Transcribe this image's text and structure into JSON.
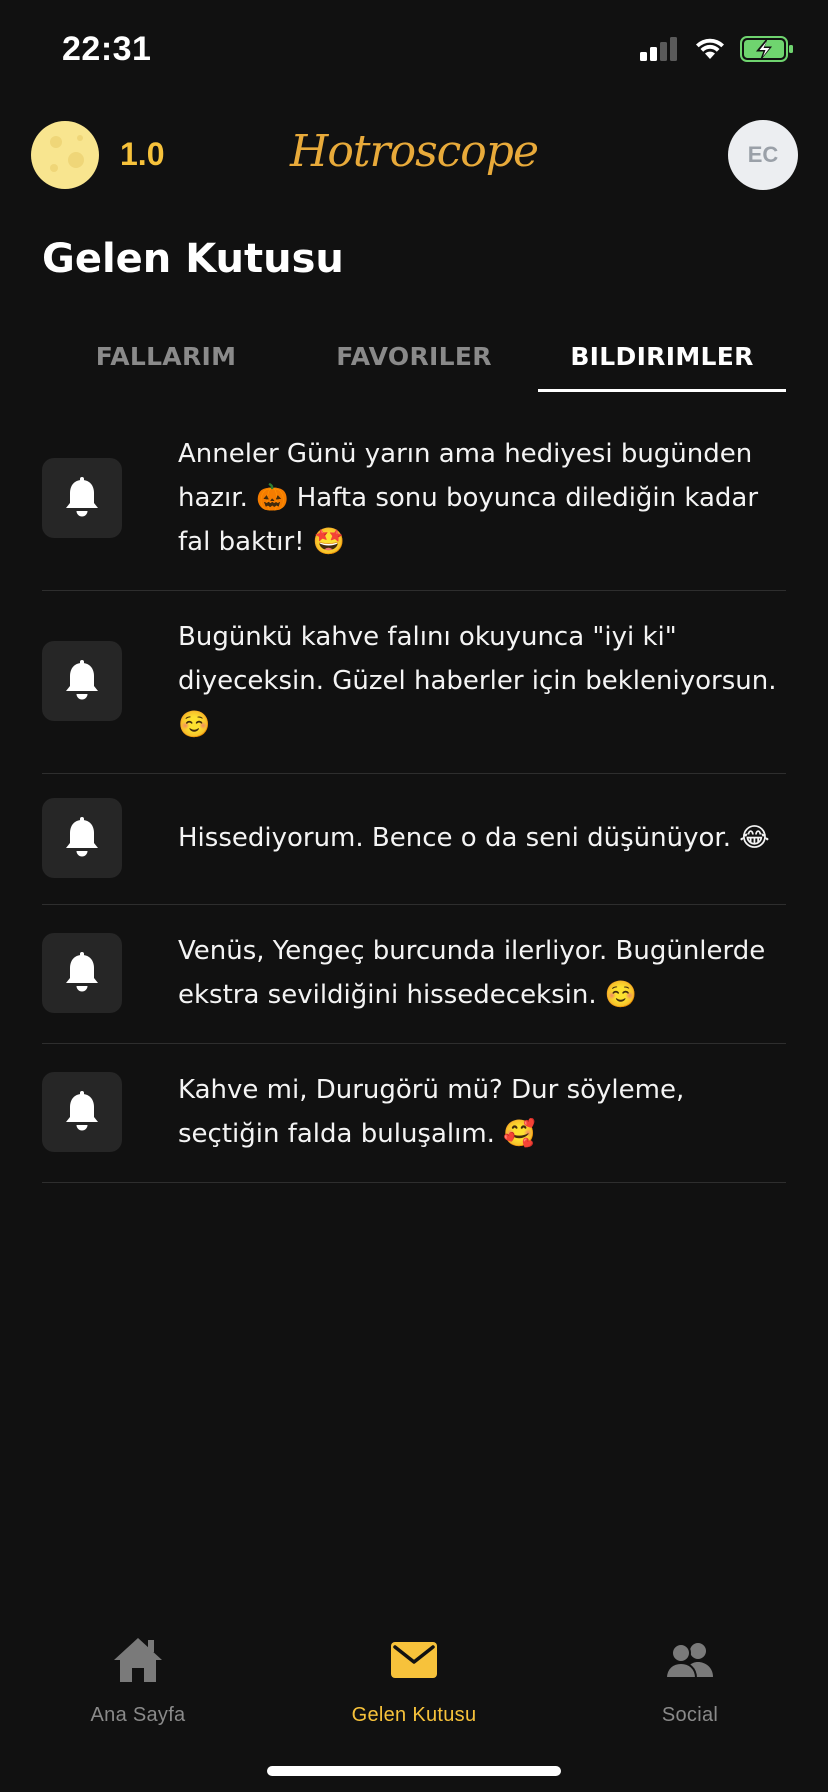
{
  "status_bar": {
    "time": "22:31",
    "icons": [
      "cellular-signal-icon",
      "wifi-icon",
      "battery-charging-icon"
    ]
  },
  "header": {
    "moon_icon": "moon-icon",
    "moon_value": "1.0",
    "brand": "Hotroscope",
    "avatar_initials": "EC"
  },
  "page": {
    "title": "Gelen Kutusu"
  },
  "tabs": [
    {
      "label": "FALLARIM",
      "active": false
    },
    {
      "label": "FAVORILER",
      "active": false
    },
    {
      "label": "BILDIRIMLER",
      "active": true
    }
  ],
  "notifications": [
    {
      "icon": "bell-icon",
      "text": "Anneler Günü yarın ama hediyesi bugünden hazır. 🎃 Hafta sonu boyunca dilediğin kadar fal baktır! 🤩"
    },
    {
      "icon": "bell-icon",
      "text": "Bugünkü kahve falını okuyunca \"iyi ki\" diyeceksin. Güzel haberler için bekleniyorsun. ☺️"
    },
    {
      "icon": "bell-icon",
      "text": "Hissediyorum. Bence o da seni düşünüyor. 😂"
    },
    {
      "icon": "bell-icon",
      "text": "Venüs, Yengeç burcunda ilerliyor. Bugünlerde ekstra sevildiğini hissedeceksin. ☺️"
    },
    {
      "icon": "bell-icon",
      "text": "Kahve mi, Durugörü mü? Dur söyleme, seçtiğin falda buluşalım. 🥰"
    }
  ],
  "bottom_nav": [
    {
      "label": "Ana Sayfa",
      "icon": "home-icon",
      "active": false
    },
    {
      "label": "Gelen Kutusu",
      "icon": "envelope-icon",
      "active": true
    },
    {
      "label": "Social",
      "icon": "people-icon",
      "active": false
    }
  ],
  "colors": {
    "background": "#111111",
    "accent": "#f7c23b",
    "brand": "#e8aa3a",
    "inactive": "#8a8a8a",
    "card": "#262626"
  }
}
